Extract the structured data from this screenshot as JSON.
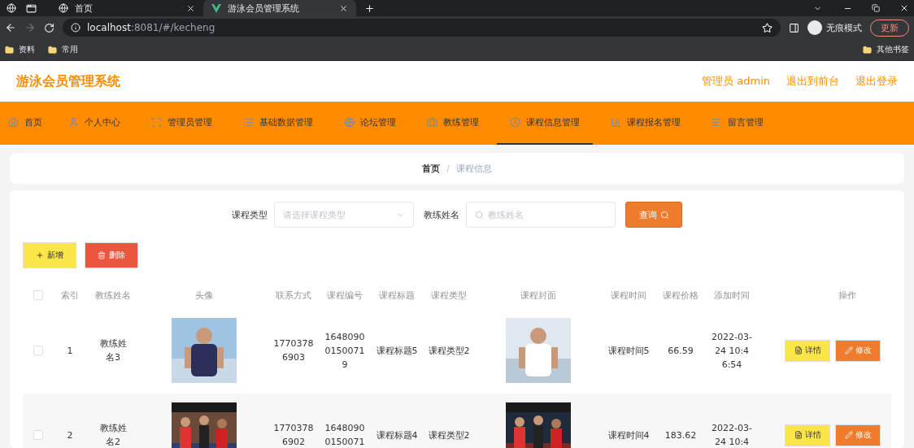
{
  "browser": {
    "tabs": [
      {
        "title": "首页",
        "selected": false
      },
      {
        "title": "游泳会员管理系统",
        "selected": true
      }
    ],
    "url_host": "localhost",
    "url_rest": ":8081/#/kecheng",
    "incognito_label": "无痕模式",
    "update_button": "更新",
    "bookmarks": [
      "资料",
      "常用"
    ],
    "other_bookmarks": "其他书签"
  },
  "header": {
    "title": "游泳会员管理系统",
    "links": [
      "管理员 admin",
      "退出到前台",
      "退出登录"
    ]
  },
  "nav": [
    {
      "label": "首页",
      "selected": false
    },
    {
      "label": "个人中心",
      "selected": false
    },
    {
      "label": "管理员管理",
      "selected": false
    },
    {
      "label": "基础数据管理",
      "selected": false
    },
    {
      "label": "论坛管理",
      "selected": false
    },
    {
      "label": "教练管理",
      "selected": false
    },
    {
      "label": "课程信息管理",
      "selected": true
    },
    {
      "label": "课程报名管理",
      "selected": false
    },
    {
      "label": "留言管理",
      "selected": false
    }
  ],
  "breadcrumb": [
    "首页",
    "课程信息"
  ],
  "breadcrumb_separator": "/",
  "search": {
    "fields": [
      {
        "label": "课程类型",
        "placeholder": "请选择课程类型",
        "kind": "select"
      },
      {
        "label": "教练姓名",
        "placeholder": "教练姓名",
        "kind": "text"
      }
    ],
    "button": "查询"
  },
  "actions": [
    {
      "label": "新增",
      "kind": "add"
    },
    {
      "label": "删除",
      "kind": "delete"
    }
  ],
  "table": {
    "select_all_checked": false,
    "columns": [
      "索引",
      "教练姓名",
      "头像",
      "联系方式",
      "课程编号",
      "课程标题",
      "课程类型",
      "课程封面",
      "课程时间",
      "课程价格",
      "添加时间",
      "操作"
    ],
    "rows": [
      {
        "checked": false,
        "index": "1",
        "coach": "教练姓名3",
        "contact": "17703786903",
        "code": "164809001500719",
        "title": "课程标题5",
        "type": "课程类型2",
        "time": "课程时间5",
        "price": "66.59",
        "added": "2022-03-24 10:46:54",
        "buttons": [
          "详情",
          "修改"
        ]
      },
      {
        "checked": false,
        "index": "2",
        "coach": "教练姓名2",
        "contact": "17703786902",
        "code": "16480900150071",
        "title": "课程标题4",
        "type": "课程类型2",
        "time": "课程时间4",
        "price": "183.62",
        "added": "2022-03-24 10:4",
        "buttons": [
          "详情",
          "修改"
        ]
      }
    ]
  }
}
